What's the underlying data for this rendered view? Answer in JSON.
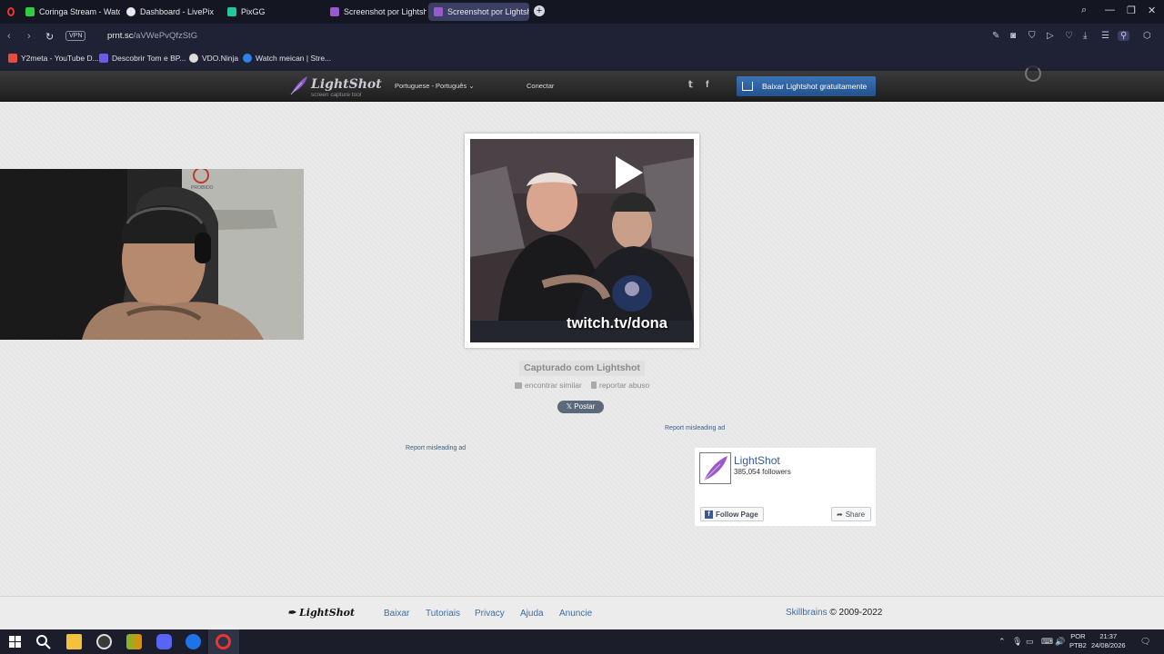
{
  "browser": {
    "tabs": [
      {
        "label": "Coringa Stream - Watch L",
        "favicon_color": "#2ecc40"
      },
      {
        "label": "Dashboard - LivePix",
        "favicon_color": "#e8e8ee"
      },
      {
        "label": "PixGG",
        "favicon_color": "#20c997"
      },
      {
        "label": "Screenshot por Lightshot",
        "favicon_color": "#9b59d0"
      },
      {
        "label": "Screenshot por Lightshot",
        "favicon_color": "#9b59d0"
      }
    ],
    "active_tab_index": 4,
    "url_host": "prnt.sc",
    "url_path": "/aVWePvQfzStG",
    "vpn_label": "VPN",
    "bookmarks": [
      {
        "label": "Y2meta - YouTube D...",
        "favicon_color": "#e74c3c"
      },
      {
        "label": "Descobrir Tom e BP...",
        "favicon_color": "#6c5ce7"
      },
      {
        "label": "VDO.Ninja",
        "favicon_color": "#dddddd"
      },
      {
        "label": "Watch meican | Stre...",
        "favicon_color": "#2f80ed"
      }
    ]
  },
  "header": {
    "logo_name": "LightShot",
    "logo_tagline": "screen capture tool",
    "language": "Portuguese - Português",
    "login_label": "Conectar",
    "download_button": "Baixar Lightshot gratuitamente"
  },
  "screenshot": {
    "overlay_text": "twitch.tv/dona",
    "caption": "Capturado com Lightshot",
    "find_similar": "encontrar similar",
    "report_abuse": "reportar abuso",
    "tweet_label": "Postar"
  },
  "ads": {
    "report_label": "Report misleading ad"
  },
  "facebook": {
    "page_name": "LightShot",
    "followers": "385,054 followers",
    "follow_label": "Follow Page",
    "share_label": "Share"
  },
  "footer": {
    "logo": "LightShot",
    "links": [
      "Baixar",
      "Tutoriais",
      "Privacy",
      "Ajuda",
      "Anuncie"
    ],
    "company": "Skillbrains",
    "copyright": "© 2009-2022"
  },
  "taskbar": {
    "lang_line1": "POR",
    "lang_line2": "PTB2",
    "time": "21:37",
    "date": "24/08/2026"
  }
}
